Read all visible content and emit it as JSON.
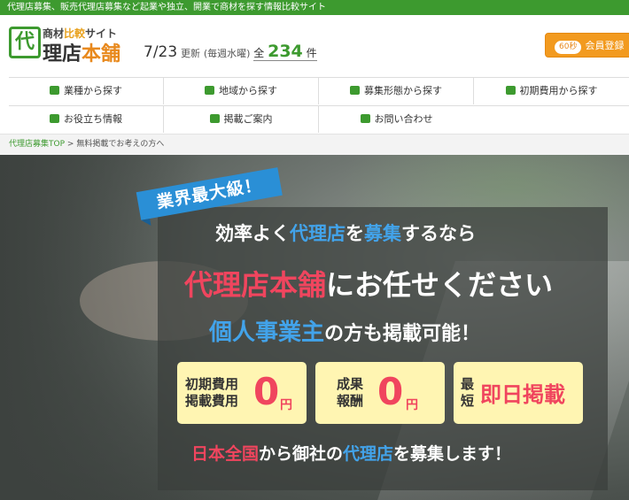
{
  "topbar": {
    "text": "代理店募集、販売代理店募集など起業や独立、開業で商材を探す情報比較サイト"
  },
  "logo": {
    "mark": "代",
    "sub_pre": "商材",
    "sub_accent": "比較",
    "sub_post": "サイト",
    "main_pre": "理店",
    "main_accent": "本舗"
  },
  "update": {
    "date": "7/23",
    "label": "更新",
    "schedule": "(毎週水曜)",
    "total_label": "全",
    "count": "234",
    "unit": "件"
  },
  "register": {
    "badge": "60秒",
    "label": "会員登録"
  },
  "nav": {
    "items": [
      {
        "label": "業種から探す",
        "icon": "briefcase-icon"
      },
      {
        "label": "地域から探す",
        "icon": "map-icon"
      },
      {
        "label": "募集形態から探す",
        "icon": "id-card-icon"
      },
      {
        "label": "初期費用から探す",
        "icon": "coins-icon"
      },
      {
        "label": "お役立ち情報",
        "icon": "book-icon"
      },
      {
        "label": "掲載ご案内",
        "icon": "bookmark-icon"
      },
      {
        "label": "お問い合わせ",
        "icon": "envelope-icon"
      }
    ]
  },
  "breadcrumb": {
    "home": "代理店募集TOP",
    "separator": ">",
    "current": "無料掲載でお考えの方へ"
  },
  "hero": {
    "ribbon": "業界最大級！",
    "line1_a": "効率よく",
    "line1_b": "代理店",
    "line1_c": "を",
    "line1_d": "募集",
    "line1_e": "するなら",
    "line2_a": "代理店本舗",
    "line2_b": "にお任せください",
    "line3_a": "個人事業主",
    "line3_b": "の方も掲載可能！",
    "card1": {
      "label1": "初期費用",
      "label2": "掲載費用",
      "zero": "0",
      "yen": "円"
    },
    "card2": {
      "label1": "成果",
      "label2": "報酬",
      "zero": "0",
      "yen": "円"
    },
    "card3": {
      "label1": "最",
      "label2": "短",
      "big": "即日掲載"
    },
    "line4_a": "日本全国",
    "line4_b": "から御社の",
    "line4_c": "代理店",
    "line4_d": "を募集します！"
  },
  "colors": {
    "brand_green": "#3d9a2f",
    "accent_orange": "#f29a1f",
    "hero_red": "#f0455e",
    "hero_blue": "#42a3ea",
    "ribbon_blue": "#2a8fd6",
    "card_yellow": "#fff5b2"
  }
}
